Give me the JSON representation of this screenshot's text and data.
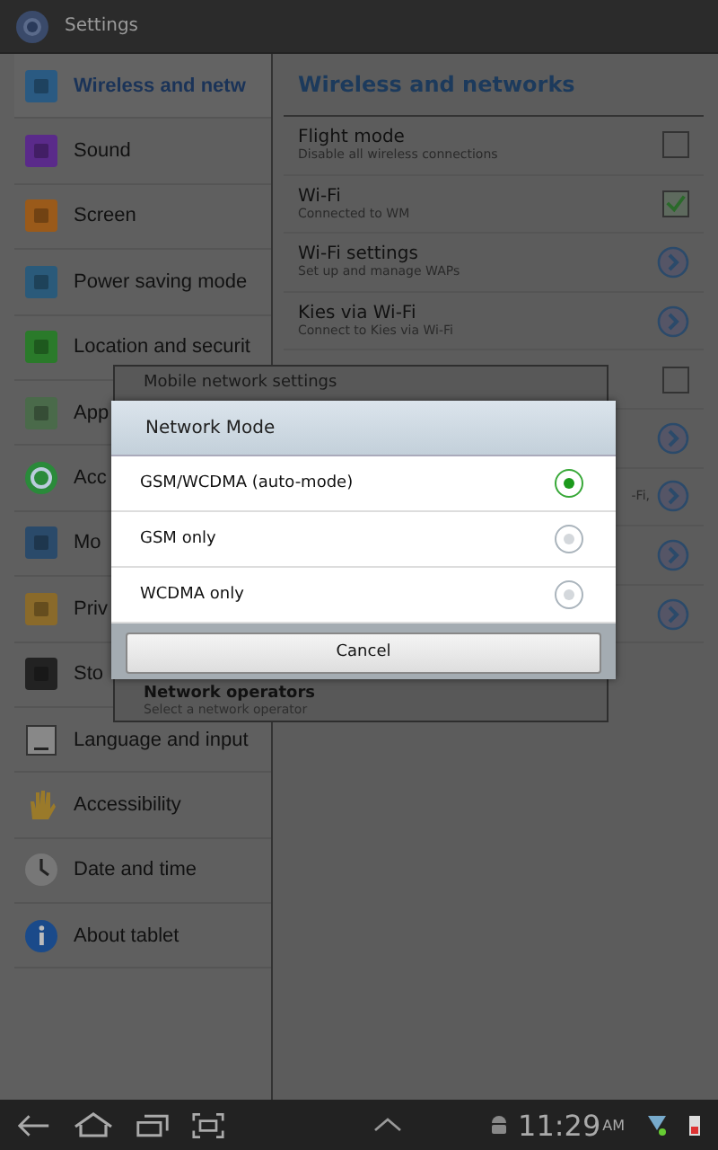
{
  "title_bar": {
    "title": "Settings"
  },
  "sidebar": {
    "items": [
      {
        "label": "Wireless and netw",
        "selected": true
      },
      {
        "label": "Sound",
        "selected": false
      },
      {
        "label": "Screen",
        "selected": false
      },
      {
        "label": "Power saving mode",
        "selected": false
      },
      {
        "label": "Location and securit",
        "selected": false
      },
      {
        "label": "App",
        "selected": false
      },
      {
        "label": "Acc",
        "selected": false
      },
      {
        "label": "Mo",
        "selected": false
      },
      {
        "label": "Priv",
        "selected": false
      },
      {
        "label": "Sto",
        "selected": false
      },
      {
        "label": "Language and input",
        "selected": false
      },
      {
        "label": "Accessibility",
        "selected": false
      },
      {
        "label": "Date and time",
        "selected": false
      },
      {
        "label": "About tablet",
        "selected": false
      }
    ]
  },
  "panel": {
    "title": "Wireless and networks",
    "rows": [
      {
        "kind": "checkbox",
        "title": "Flight mode",
        "subtitle": "Disable all wireless connections",
        "checked": false
      },
      {
        "kind": "checkbox",
        "title": "Wi-Fi",
        "subtitle": "Connected to WM",
        "checked": true
      },
      {
        "kind": "link",
        "title": "Wi-Fi settings",
        "subtitle": "Set up and manage WAPs"
      },
      {
        "kind": "link",
        "title": "Kies via Wi-Fi",
        "subtitle": "Connect to Kies via Wi-Fi"
      },
      {
        "kind": "checkbox",
        "checked": false
      },
      {
        "kind": "link"
      },
      {
        "kind": "link",
        "subtitle": "-Fi,"
      },
      {
        "kind": "link"
      },
      {
        "kind": "link"
      }
    ]
  },
  "back_dialog": {
    "title": "Mobile network settings",
    "items": [
      {
        "title": "Network operators",
        "subtitle": "Select a network operator"
      }
    ]
  },
  "dialog": {
    "title": "Network Mode",
    "options": [
      {
        "label": "GSM/WCDMA (auto-mode)",
        "selected": true
      },
      {
        "label": "GSM only",
        "selected": false
      },
      {
        "label": "WCDMA only",
        "selected": false
      }
    ],
    "button": "Cancel"
  },
  "nav_bar": {
    "time": "11:29",
    "period": "AM"
  }
}
